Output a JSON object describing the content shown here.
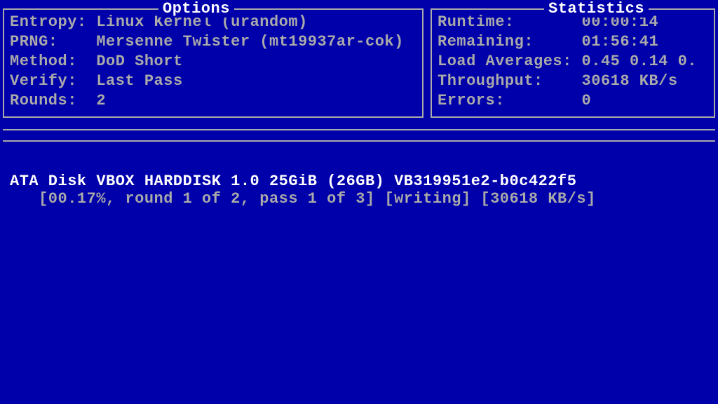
{
  "panels": {
    "options": {
      "title": "Options",
      "entropy_label": "Entropy:",
      "entropy_value": "Linux Kernel (urandom)",
      "prng_label": "PRNG:",
      "prng_value": "Mersenne Twister (mt19937ar-cok)",
      "method_label": "Method:",
      "method_value": "DoD Short",
      "verify_label": "Verify:",
      "verify_value": "Last Pass",
      "rounds_label": "Rounds:",
      "rounds_value": "2"
    },
    "statistics": {
      "title": "Statistics",
      "runtime_label": "Runtime:",
      "runtime_value": "00:00:14",
      "remaining_label": "Remaining:",
      "remaining_value": "01:56:41",
      "loadavg_label": "Load Averages:",
      "loadavg_value": "0.45 0.14 0.",
      "throughput_label": "Throughput:",
      "throughput_value": "30618 KB/s",
      "errors_label": "Errors:",
      "errors_value": "0"
    }
  },
  "main": {
    "disk_line": "ATA Disk VBOX HARDDISK 1.0 25GiB (26GB) VB319951e2-b0c422f5",
    "status_line": "   [00.17%, round 1 of 2, pass 1 of 3] [writing] [30618 KB/s]"
  }
}
